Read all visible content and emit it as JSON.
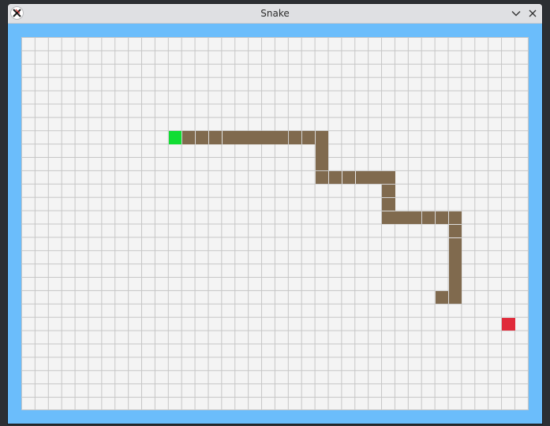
{
  "window": {
    "title": "Snake",
    "app_icon": "x-app-icon",
    "minimize_icon": "chevron-down-icon",
    "close_icon": "close-icon"
  },
  "colors": {
    "frame": "#6bbdfb",
    "board": "#f4f4f4",
    "grid_line": "#c6c6c6",
    "snake_body": "#806a4e",
    "snake_head": "#11dd33",
    "food": "#e02a3a"
  },
  "game": {
    "grid_cols": 38,
    "grid_rows": 28,
    "snake_head": [
      11,
      7
    ],
    "snake_body": [
      [
        12,
        7
      ],
      [
        13,
        7
      ],
      [
        14,
        7
      ],
      [
        15,
        7
      ],
      [
        16,
        7
      ],
      [
        17,
        7
      ],
      [
        18,
        7
      ],
      [
        19,
        7
      ],
      [
        20,
        7
      ],
      [
        21,
        7
      ],
      [
        22,
        7
      ],
      [
        22,
        8
      ],
      [
        22,
        9
      ],
      [
        22,
        10
      ],
      [
        23,
        10
      ],
      [
        24,
        10
      ],
      [
        25,
        10
      ],
      [
        26,
        10
      ],
      [
        27,
        10
      ],
      [
        27,
        11
      ],
      [
        27,
        12
      ],
      [
        27,
        13
      ],
      [
        28,
        13
      ],
      [
        29,
        13
      ],
      [
        30,
        13
      ],
      [
        31,
        13
      ],
      [
        32,
        13
      ],
      [
        32,
        14
      ],
      [
        32,
        15
      ],
      [
        32,
        16
      ],
      [
        32,
        17
      ],
      [
        32,
        18
      ],
      [
        32,
        19
      ],
      [
        31,
        19
      ]
    ],
    "food": [
      36,
      21
    ]
  }
}
